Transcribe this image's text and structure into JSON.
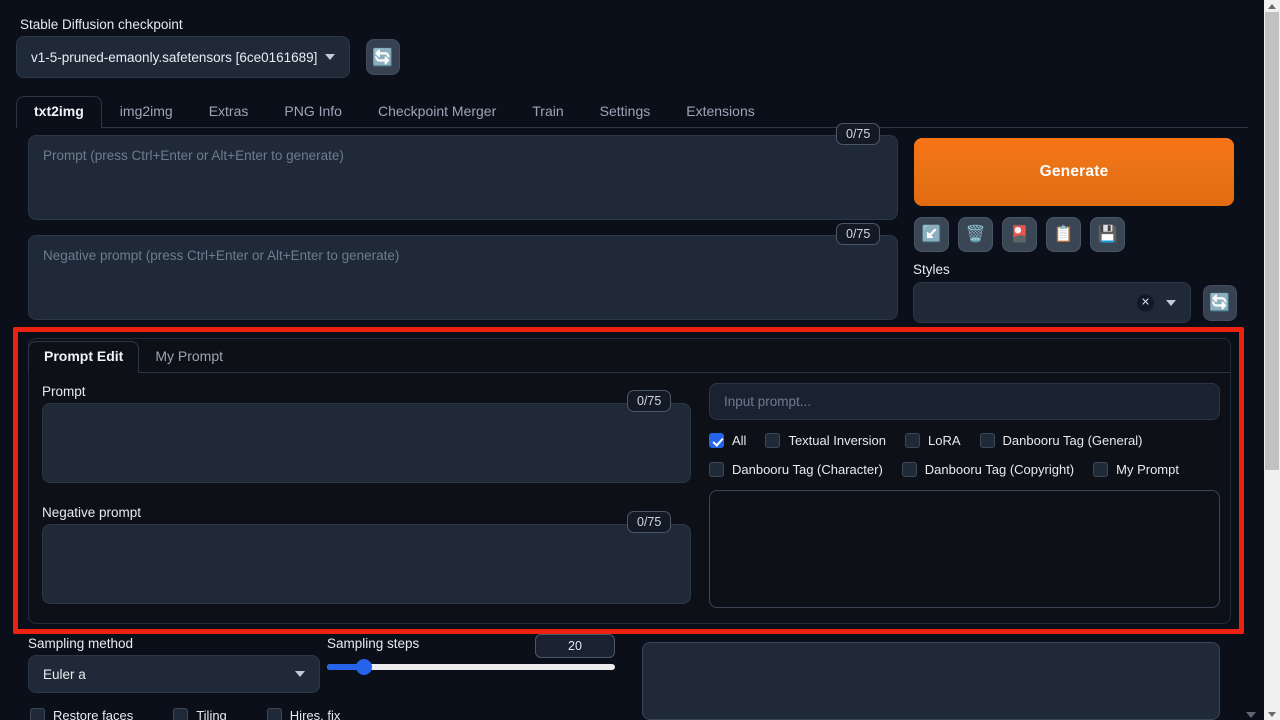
{
  "checkpoint": {
    "label": "Stable Diffusion checkpoint",
    "value": "v1-5-pruned-emaonly.safetensors [6ce0161689]",
    "refresh_icon": "refresh-icon"
  },
  "main_tabs": [
    {
      "label": "txt2img",
      "active": true
    },
    {
      "label": "img2img",
      "active": false
    },
    {
      "label": "Extras",
      "active": false
    },
    {
      "label": "PNG Info",
      "active": false
    },
    {
      "label": "Checkpoint Merger",
      "active": false
    },
    {
      "label": "Train",
      "active": false
    },
    {
      "label": "Settings",
      "active": false
    },
    {
      "label": "Extensions",
      "active": false
    }
  ],
  "prompt": {
    "placeholder": "Prompt (press Ctrl+Enter or Alt+Enter to generate)",
    "value": "",
    "counter": "0/75"
  },
  "negative_prompt": {
    "placeholder": "Negative prompt (press Ctrl+Enter or Alt+Enter to generate)",
    "value": "",
    "counter": "0/75"
  },
  "generate": {
    "label": "Generate"
  },
  "tools": [
    {
      "name": "arrow-down-left-icon",
      "glyph": "↙️",
      "title": "arrow"
    },
    {
      "name": "trash-icon",
      "glyph": "🗑️",
      "title": "clear"
    },
    {
      "name": "flower-card-icon",
      "glyph": "🎴",
      "title": "styles"
    },
    {
      "name": "clipboard-icon",
      "glyph": "📋",
      "title": "paste"
    },
    {
      "name": "floppy-disk-icon",
      "glyph": "💾",
      "title": "save style"
    }
  ],
  "styles": {
    "label": "Styles",
    "value": "",
    "clear_glyph": "✕",
    "refresh_icon": "refresh-icon"
  },
  "prompt_edit": {
    "tabs": [
      {
        "label": "Prompt Edit",
        "active": true
      },
      {
        "label": "My Prompt",
        "active": false
      }
    ],
    "prompt_label": "Prompt",
    "prompt_value": "",
    "prompt_counter": "0/75",
    "negative_label": "Negative prompt",
    "negative_value": "",
    "negative_counter": "0/75",
    "search_placeholder": "Input prompt...",
    "search_value": "",
    "filters_row1": [
      {
        "label": "All",
        "checked": true
      },
      {
        "label": "Textual Inversion",
        "checked": false
      },
      {
        "label": "LoRA",
        "checked": false
      },
      {
        "label": "Danbooru Tag (General)",
        "checked": false
      }
    ],
    "filters_row2": [
      {
        "label": "Danbooru Tag (Character)",
        "checked": false
      },
      {
        "label": "Danbooru Tag (Copyright)",
        "checked": false
      },
      {
        "label": "My Prompt",
        "checked": false
      }
    ],
    "results": ""
  },
  "sampling": {
    "method_label": "Sampling method",
    "method_value": "Euler a",
    "steps_label": "Sampling steps",
    "steps_value": "20",
    "steps_min": 1,
    "steps_max": 150,
    "steps_percent": 13
  },
  "options": [
    {
      "label": "Restore faces",
      "checked": false
    },
    {
      "label": "Tiling",
      "checked": false
    },
    {
      "label": "Hires. fix",
      "checked": false
    }
  ],
  "highlight": {
    "color": "#ee2211"
  },
  "scrollbar": {
    "up_icon": "scroll-up-arrow-icon",
    "down_icon": "scroll-down-arrow-icon"
  }
}
